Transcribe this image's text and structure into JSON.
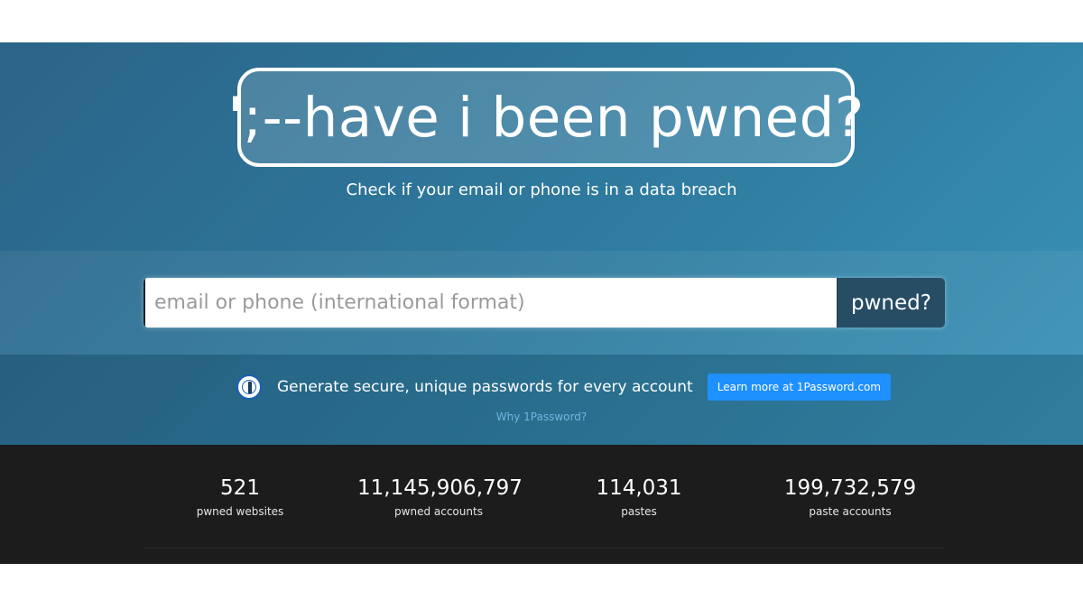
{
  "logo": {
    "text": "';--have i been pwned?"
  },
  "tagline": "Check if your email or phone is in a data breach",
  "search": {
    "placeholder": "email or phone (international format)",
    "value": "",
    "button_label": "pwned?"
  },
  "promo": {
    "icon": "1password-icon",
    "text": "Generate secure, unique passwords for every account",
    "button_label": "Learn more at 1Password.com",
    "link_label": "Why 1Password?"
  },
  "stats": [
    {
      "value": "521",
      "label": "pwned websites"
    },
    {
      "value": "11,145,906,797",
      "label": "pwned accounts"
    },
    {
      "value": "114,031",
      "label": "pastes"
    },
    {
      "value": "199,732,579",
      "label": "paste accounts"
    }
  ],
  "colors": {
    "hero_gradient_start": "#2a6488",
    "hero_gradient_end": "#3a93b8",
    "search_button": "#274d64",
    "promo_button": "#1e90ff",
    "stats_background": "#1c1c1c",
    "link": "#6fb6e0"
  }
}
